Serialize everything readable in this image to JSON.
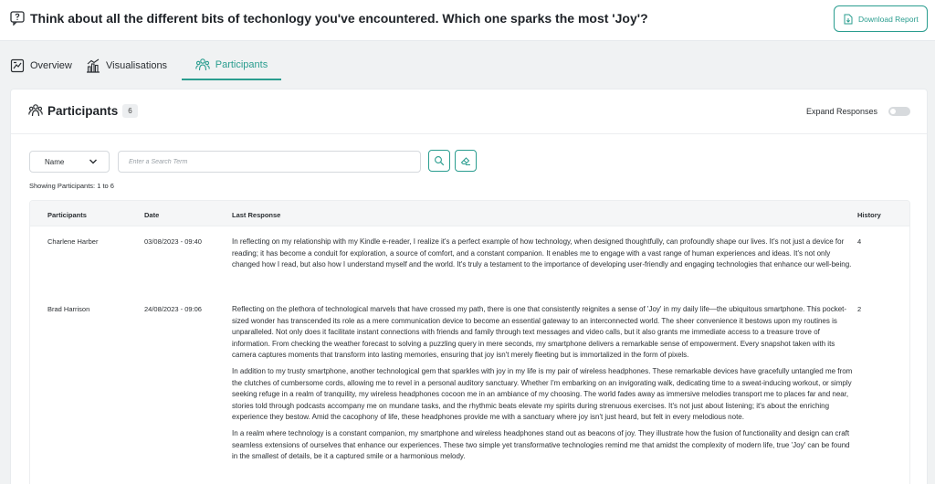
{
  "question": "Think about all the different bits of techonlogy you've encountered. Which one sparks the most 'Joy'?",
  "download_label": "Download Report",
  "tabs": [
    {
      "label": "Overview",
      "icon": "overview-icon"
    },
    {
      "label": "Visualisations",
      "icon": "chart-icon"
    },
    {
      "label": "Participants",
      "icon": "participants-icon",
      "active": true
    }
  ],
  "panel": {
    "title": "Participants",
    "count": "6",
    "expand_label": "Expand Responses",
    "filter_value": "Name",
    "search_placeholder": "Enter a Search Term",
    "showing": "Showing Participants: 1 to 6"
  },
  "columns": [
    "Participants",
    "Date",
    "Last Response",
    "History"
  ],
  "rows": [
    {
      "name": "Charlene Harber",
      "date": "03/08/2023 - 09:40",
      "history": "4",
      "paragraphs": [
        "In reflecting on my relationship with my Kindle e-reader, I realize it's a perfect example of how technology, when designed thoughtfully, can profoundly shape our lives. It's not just a device for reading; it has become a conduit for exploration, a source of comfort, and a constant companion. It enables me to engage with a vast range of human experiences and ideas. It's not only changed how I read, but also how I understand myself and the world. It's truly a testament to the importance of developing user-friendly and engaging technologies that enhance our well-being."
      ]
    },
    {
      "name": "Brad Harrison",
      "date": "24/08/2023 - 09:06",
      "history": "2",
      "paragraphs": [
        "Reflecting on the plethora of technological marvels that have crossed my path, there is one that consistently reignites a sense of 'Joy' in my daily life—the ubiquitous smartphone. This pocket-sized wonder has transcended its role as a mere communication device to become an essential gateway to an interconnected world. The sheer convenience it bestows upon my routines is unparalleled. Not only does it facilitate instant connections with friends and family through text messages and video calls, but it also grants me immediate access to a treasure trove of information. From checking the weather forecast to solving a puzzling query in mere seconds, my smartphone delivers a remarkable sense of empowerment. Every snapshot taken with its camera captures moments that transform into lasting memories, ensuring that joy isn't merely fleeting but is immortalized in the form of pixels.",
        "In addition to my trusty smartphone, another technological gem that sparkles with joy in my life is my pair of wireless headphones. These remarkable devices have gracefully untangled me from the clutches of cumbersome cords, allowing me to revel in a personal auditory sanctuary. Whether I'm embarking on an invigorating walk, dedicating time to a sweat-inducing workout, or simply seeking refuge in a realm of tranquility, my wireless headphones cocoon me in an ambiance of my choosing. The world fades away as immersive melodies transport me to places far and near, stories told through podcasts accompany me on mundane tasks, and the rhythmic beats elevate my spirits during strenuous exercises. It's not just about listening; it's about the enriching experience they bestow. Amid the cacophony of life, these headphones provide me with a sanctuary where joy isn't just heard, but felt in every melodious note.",
        "In a realm where technology is a constant companion, my smartphone and wireless headphones stand out as beacons of joy. They illustrate how the fusion of functionality and design can craft seamless extensions of ourselves that enhance our experiences. These two simple yet transformative technologies remind me that amidst the complexity of modern life, true 'Joy' can be found in the smallest of details, be it a captured smile or a harmonious melody."
      ]
    }
  ],
  "colors": {
    "accent": "#2a9d8f",
    "page_bg": "#f0f2f3"
  }
}
